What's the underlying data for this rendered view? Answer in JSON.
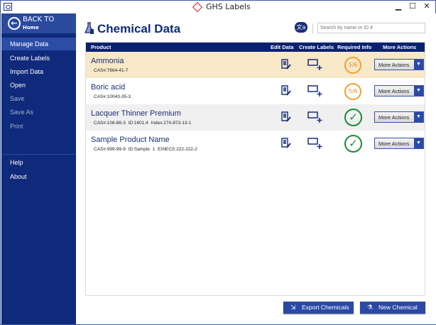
{
  "window": {
    "title": "GHS Labels",
    "minimize": "▁",
    "maximize": "☐",
    "close": "✕"
  },
  "sidebar": {
    "back_title": "BACK TO",
    "back_sub": "Home",
    "items": [
      {
        "label": "Manage Data",
        "active": true
      },
      {
        "label": "Create Labels"
      },
      {
        "label": "Import Data"
      },
      {
        "label": "Open"
      },
      {
        "label": "Save",
        "disabled": true
      },
      {
        "label": "Save As",
        "disabled": true
      },
      {
        "label": "Print",
        "disabled": true
      },
      {
        "label": "Help"
      },
      {
        "label": "About"
      }
    ]
  },
  "header": {
    "title": "Chemical Data",
    "translate_label": "文a",
    "search_placeholder": "Search by name or ID #"
  },
  "table": {
    "columns": [
      "Product",
      "Edit Data",
      "Create Labels",
      "Required Info",
      "More Actions"
    ],
    "rows": [
      {
        "name": "Ammonia",
        "sub": "CAS#:7664-41-7",
        "status": "5/6",
        "action": "More Actions"
      },
      {
        "name": "Boric acid",
        "sub": "CAS#:10043-35-3",
        "status": "5/6",
        "action": "More Actions"
      },
      {
        "name": "Lacquer Thinner Premium",
        "sub": "CAS#:108-88-3  ID:1601.4  Index:274-873-13-1",
        "status": "complete",
        "action": "More Actions"
      },
      {
        "name": "Sample Product Name",
        "sub": "CAS#:999-99-9  ID:Sample 1  EINECS:222-222-2",
        "status": "complete",
        "action": "More Actions"
      }
    ]
  },
  "footer": {
    "export": "Export Chemicals",
    "new": "New Chemical"
  },
  "colors": {
    "navy": "#0f2a7a",
    "selected_row": "#f7e8c8",
    "alt_row": "#f0f0f0",
    "warning": "#f0a030",
    "ok": "#1e8a3a"
  }
}
